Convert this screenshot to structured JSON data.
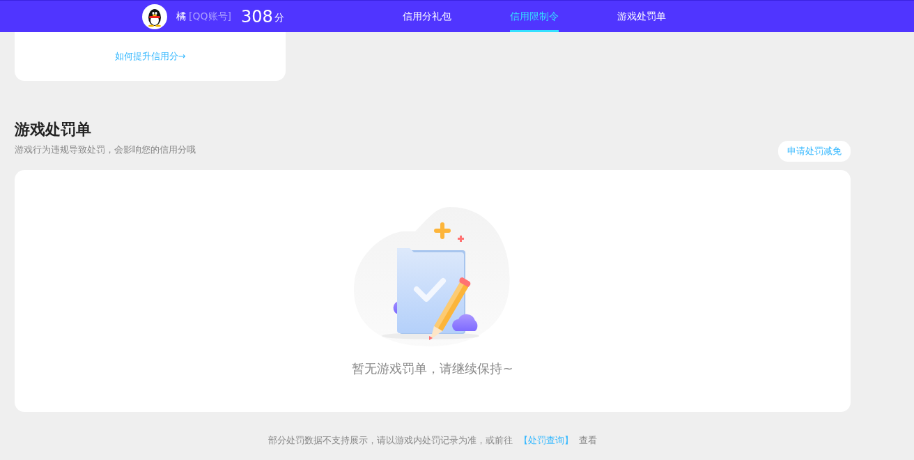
{
  "header": {
    "user_name": "橘",
    "account_type": "[QQ账号]",
    "score": "308",
    "score_unit": "分",
    "tabs": [
      {
        "label": "信用分礼包",
        "selected": false
      },
      {
        "label": "信用限制令",
        "selected": true
      },
      {
        "label": "游戏处罚单",
        "selected": false
      }
    ]
  },
  "credit_card": {
    "link": "如何提升信用分→"
  },
  "penalty_section": {
    "title": "游戏处罚单",
    "subtitle": "游戏行为违规导致处罚，会影响您的信用分哦",
    "appeal_button": "申请处罚减免",
    "empty_message": "暂无游戏罚单，请继续保持~"
  },
  "footer": {
    "text_before": "部分处罚数据不支持展示，请以游戏内处罚记录为准，或前往",
    "link": "【处罚查询】",
    "text_after": "查看"
  }
}
